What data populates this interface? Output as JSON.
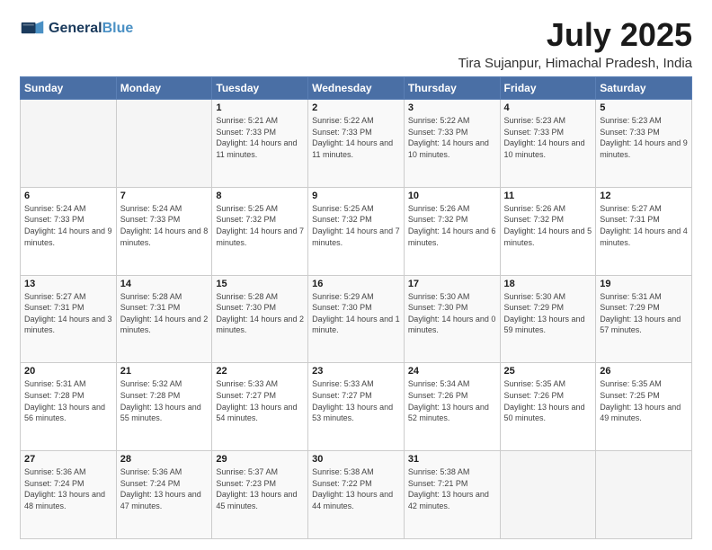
{
  "header": {
    "logo_line1": "General",
    "logo_line2": "Blue",
    "month": "July 2025",
    "location": "Tira Sujanpur, Himachal Pradesh, India"
  },
  "weekdays": [
    "Sunday",
    "Monday",
    "Tuesday",
    "Wednesday",
    "Thursday",
    "Friday",
    "Saturday"
  ],
  "weeks": [
    [
      {
        "day": "",
        "info": ""
      },
      {
        "day": "",
        "info": ""
      },
      {
        "day": "1",
        "info": "Sunrise: 5:21 AM\nSunset: 7:33 PM\nDaylight: 14 hours and 11 minutes."
      },
      {
        "day": "2",
        "info": "Sunrise: 5:22 AM\nSunset: 7:33 PM\nDaylight: 14 hours and 11 minutes."
      },
      {
        "day": "3",
        "info": "Sunrise: 5:22 AM\nSunset: 7:33 PM\nDaylight: 14 hours and 10 minutes."
      },
      {
        "day": "4",
        "info": "Sunrise: 5:23 AM\nSunset: 7:33 PM\nDaylight: 14 hours and 10 minutes."
      },
      {
        "day": "5",
        "info": "Sunrise: 5:23 AM\nSunset: 7:33 PM\nDaylight: 14 hours and 9 minutes."
      }
    ],
    [
      {
        "day": "6",
        "info": "Sunrise: 5:24 AM\nSunset: 7:33 PM\nDaylight: 14 hours and 9 minutes."
      },
      {
        "day": "7",
        "info": "Sunrise: 5:24 AM\nSunset: 7:33 PM\nDaylight: 14 hours and 8 minutes."
      },
      {
        "day": "8",
        "info": "Sunrise: 5:25 AM\nSunset: 7:32 PM\nDaylight: 14 hours and 7 minutes."
      },
      {
        "day": "9",
        "info": "Sunrise: 5:25 AM\nSunset: 7:32 PM\nDaylight: 14 hours and 7 minutes."
      },
      {
        "day": "10",
        "info": "Sunrise: 5:26 AM\nSunset: 7:32 PM\nDaylight: 14 hours and 6 minutes."
      },
      {
        "day": "11",
        "info": "Sunrise: 5:26 AM\nSunset: 7:32 PM\nDaylight: 14 hours and 5 minutes."
      },
      {
        "day": "12",
        "info": "Sunrise: 5:27 AM\nSunset: 7:31 PM\nDaylight: 14 hours and 4 minutes."
      }
    ],
    [
      {
        "day": "13",
        "info": "Sunrise: 5:27 AM\nSunset: 7:31 PM\nDaylight: 14 hours and 3 minutes."
      },
      {
        "day": "14",
        "info": "Sunrise: 5:28 AM\nSunset: 7:31 PM\nDaylight: 14 hours and 2 minutes."
      },
      {
        "day": "15",
        "info": "Sunrise: 5:28 AM\nSunset: 7:30 PM\nDaylight: 14 hours and 2 minutes."
      },
      {
        "day": "16",
        "info": "Sunrise: 5:29 AM\nSunset: 7:30 PM\nDaylight: 14 hours and 1 minute."
      },
      {
        "day": "17",
        "info": "Sunrise: 5:30 AM\nSunset: 7:30 PM\nDaylight: 14 hours and 0 minutes."
      },
      {
        "day": "18",
        "info": "Sunrise: 5:30 AM\nSunset: 7:29 PM\nDaylight: 13 hours and 59 minutes."
      },
      {
        "day": "19",
        "info": "Sunrise: 5:31 AM\nSunset: 7:29 PM\nDaylight: 13 hours and 57 minutes."
      }
    ],
    [
      {
        "day": "20",
        "info": "Sunrise: 5:31 AM\nSunset: 7:28 PM\nDaylight: 13 hours and 56 minutes."
      },
      {
        "day": "21",
        "info": "Sunrise: 5:32 AM\nSunset: 7:28 PM\nDaylight: 13 hours and 55 minutes."
      },
      {
        "day": "22",
        "info": "Sunrise: 5:33 AM\nSunset: 7:27 PM\nDaylight: 13 hours and 54 minutes."
      },
      {
        "day": "23",
        "info": "Sunrise: 5:33 AM\nSunset: 7:27 PM\nDaylight: 13 hours and 53 minutes."
      },
      {
        "day": "24",
        "info": "Sunrise: 5:34 AM\nSunset: 7:26 PM\nDaylight: 13 hours and 52 minutes."
      },
      {
        "day": "25",
        "info": "Sunrise: 5:35 AM\nSunset: 7:26 PM\nDaylight: 13 hours and 50 minutes."
      },
      {
        "day": "26",
        "info": "Sunrise: 5:35 AM\nSunset: 7:25 PM\nDaylight: 13 hours and 49 minutes."
      }
    ],
    [
      {
        "day": "27",
        "info": "Sunrise: 5:36 AM\nSunset: 7:24 PM\nDaylight: 13 hours and 48 minutes."
      },
      {
        "day": "28",
        "info": "Sunrise: 5:36 AM\nSunset: 7:24 PM\nDaylight: 13 hours and 47 minutes."
      },
      {
        "day": "29",
        "info": "Sunrise: 5:37 AM\nSunset: 7:23 PM\nDaylight: 13 hours and 45 minutes."
      },
      {
        "day": "30",
        "info": "Sunrise: 5:38 AM\nSunset: 7:22 PM\nDaylight: 13 hours and 44 minutes."
      },
      {
        "day": "31",
        "info": "Sunrise: 5:38 AM\nSunset: 7:21 PM\nDaylight: 13 hours and 42 minutes."
      },
      {
        "day": "",
        "info": ""
      },
      {
        "day": "",
        "info": ""
      }
    ]
  ]
}
